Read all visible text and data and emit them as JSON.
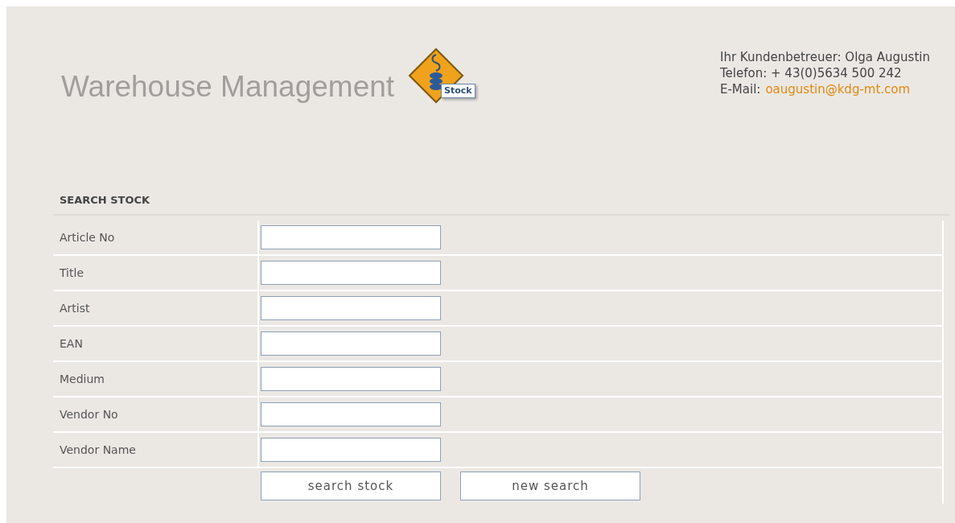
{
  "header": {
    "title": "Warehouse Management",
    "logo_badge": "Stock"
  },
  "contact": {
    "advisor": "Ihr Kundenbetreuer: Olga Augustin",
    "phone": "Telefon: + 43(0)5634 500 242",
    "email_label": "E-Mail:",
    "email": "oaugustin@kdg-mt.com"
  },
  "search": {
    "heading": "SEARCH STOCK",
    "fields": [
      {
        "label": "Article No"
      },
      {
        "label": "Title"
      },
      {
        "label": "Artist"
      },
      {
        "label": "EAN"
      },
      {
        "label": "Medium"
      },
      {
        "label": "Vendor No"
      },
      {
        "label": "Vendor Name"
      }
    ],
    "buttons": [
      "search stock",
      "new search"
    ]
  }
}
